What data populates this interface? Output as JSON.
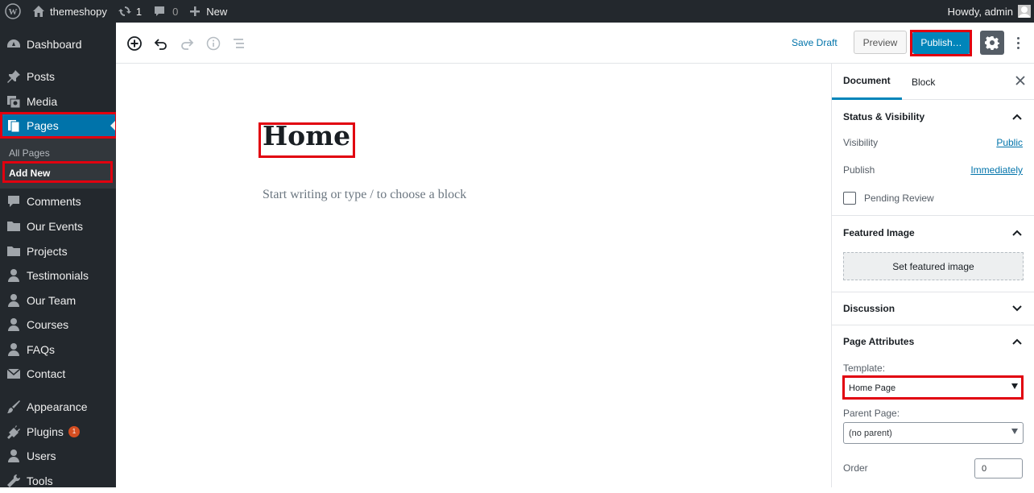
{
  "admin_bar": {
    "site_name": "themeshopy",
    "updates_count": "1",
    "comments_count": "0",
    "new_label": "New",
    "greeting": "Howdy, admin"
  },
  "sidebar": {
    "items": [
      {
        "label": "Dashboard",
        "icon": "dashboard-icon"
      },
      {
        "label": "Posts",
        "icon": "pin-icon"
      },
      {
        "label": "Media",
        "icon": "media-icon"
      },
      {
        "label": "Pages",
        "icon": "pages-icon"
      },
      {
        "label": "Comments",
        "icon": "comment-icon"
      },
      {
        "label": "Our Events",
        "icon": "folder-icon"
      },
      {
        "label": "Projects",
        "icon": "folder-icon"
      },
      {
        "label": "Testimonials",
        "icon": "user-icon"
      },
      {
        "label": "Our Team",
        "icon": "user-icon"
      },
      {
        "label": "Courses",
        "icon": "user-icon"
      },
      {
        "label": "FAQs",
        "icon": "user-icon"
      },
      {
        "label": "Contact",
        "icon": "mail-icon"
      },
      {
        "label": "Appearance",
        "icon": "brush-icon"
      },
      {
        "label": "Plugins",
        "icon": "plug-icon",
        "badge": "1"
      },
      {
        "label": "Users",
        "icon": "users-icon"
      },
      {
        "label": "Tools",
        "icon": "wrench-icon"
      }
    ],
    "submenu": [
      {
        "label": "All Pages"
      },
      {
        "label": "Add New"
      }
    ]
  },
  "toolbar": {
    "save_draft": "Save Draft",
    "preview": "Preview",
    "publish": "Publish…"
  },
  "editor": {
    "title": "Home",
    "placeholder": "Start writing or type / to choose a block"
  },
  "panel": {
    "tabs": [
      "Document",
      "Block"
    ],
    "status_visibility": {
      "heading": "Status & Visibility",
      "visibility_label": "Visibility",
      "visibility_value": "Public",
      "publish_label": "Publish",
      "publish_value": "Immediately",
      "pending_review": "Pending Review"
    },
    "featured_image": {
      "heading": "Featured Image",
      "button": "Set featured image"
    },
    "discussion": {
      "heading": "Discussion"
    },
    "page_attributes": {
      "heading": "Page Attributes",
      "template_label": "Template:",
      "template_value": "Home Page",
      "parent_label": "Parent Page:",
      "parent_value": "(no parent)",
      "order_label": "Order",
      "order_value": "0"
    }
  },
  "colors": {
    "admin_dark": "#23282d",
    "accent_blue": "#0073aa",
    "publish_blue": "#0085ba",
    "highlight_red": "#e1000f"
  }
}
